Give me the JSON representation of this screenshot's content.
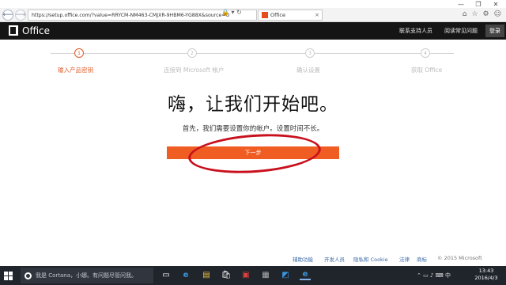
{
  "window": {
    "minimize": "—",
    "maximize": "❐",
    "close": "✕"
  },
  "browser": {
    "back_icon": "⟵",
    "forward_icon": "⟶",
    "address": "https://setup.office.com/?value=RRYCM-NM463-CMJXR-9HBM6-YG88X&source=O",
    "address_icons": "🔒 ▾ ↻",
    "tab_title": "Office",
    "tab_close": "×",
    "toolbar_icons": [
      "⌂",
      "☆",
      "⚙",
      "☺"
    ]
  },
  "header": {
    "product": "Office",
    "support_link": "联系支持人员",
    "faq_link": "阅读常见问题",
    "signin": "登录"
  },
  "steps": [
    {
      "number": "1",
      "label": "输入产品密钥",
      "active": true
    },
    {
      "number": "2",
      "label": "连接到 Microsoft 帐户",
      "active": false
    },
    {
      "number": "3",
      "label": "确认设置",
      "active": false
    },
    {
      "number": "4",
      "label": "获取 Office",
      "active": false
    }
  ],
  "main": {
    "headline": "嗨，让我们开始吧。",
    "subline": "首先，我们需要设置你的帐户。设置时间不长。",
    "next_button": "下一步"
  },
  "footer": {
    "links": [
      "辅助功能",
      "开发人员",
      "隐私和 Cookie",
      "法律",
      "商标"
    ],
    "copyright": "© 2015 Microsoft"
  },
  "taskbar": {
    "search_text": "我是 Cortana，小娜。有问题尽管问我。",
    "apps": [
      "▭",
      "e",
      "▤",
      "🛍",
      "▣",
      "▦",
      "◩",
      "e"
    ],
    "tray_icons": "⌃ ▭ ♪ ⌨ 中",
    "time": "13:43",
    "date": "2016/4/3"
  },
  "colors": {
    "accent": "#f05d22",
    "header_bg": "#151515",
    "annotation_red": "#c8101d"
  }
}
